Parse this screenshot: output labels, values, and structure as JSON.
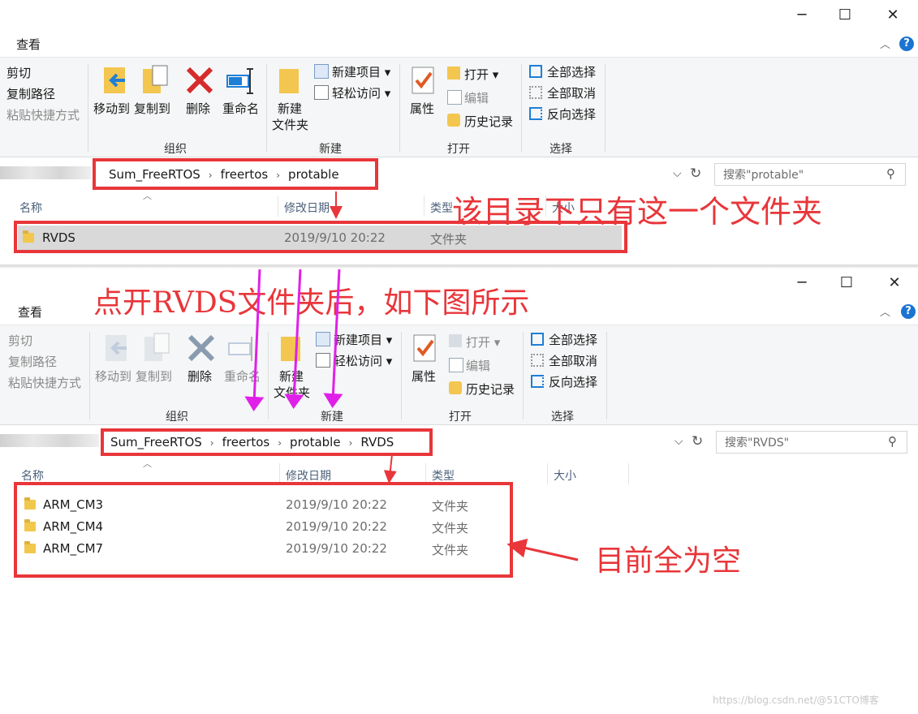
{
  "window1": {
    "title_buttons": {
      "minimize": "─",
      "maximize": "☐",
      "close": "✕"
    },
    "tab": "查看",
    "ribbon": {
      "clipboard": {
        "cut": "剪切",
        "copy_path": "复制路径",
        "paste_shortcut": "粘贴快捷方式"
      },
      "organize": {
        "move_to": "移动到",
        "copy_to": "复制到",
        "delete": "删除",
        "rename": "重命名",
        "label": "组织"
      },
      "new": {
        "new_folder_line1": "新建",
        "new_folder_line2": "文件夹",
        "new_item": "新建项目",
        "easy_access": "轻松访问",
        "label": "新建"
      },
      "open": {
        "properties": "属性",
        "open": "打开",
        "edit": "编辑",
        "history": "历史记录",
        "label": "打开"
      },
      "select": {
        "select_all": "全部选择",
        "select_none": "全部取消",
        "invert": "反向选择",
        "label": "选择"
      }
    },
    "breadcrumb": [
      "Sum_FreeRTOS",
      "freertos",
      "protable"
    ],
    "search_placeholder": "搜索\"protable\"",
    "columns": {
      "name": "名称",
      "date": "修改日期",
      "type": "类型",
      "size": "大小"
    },
    "rows": [
      {
        "name": "RVDS",
        "date": "2019/9/10 20:22",
        "type": "文件夹"
      }
    ]
  },
  "window2": {
    "title_buttons": {
      "minimize": "─",
      "maximize": "☐",
      "close": "✕"
    },
    "tab": "查看",
    "ribbon": {
      "clipboard": {
        "cut": "剪切",
        "copy_path": "复制路径",
        "paste_shortcut": "粘贴快捷方式"
      },
      "organize": {
        "move_to": "移动到",
        "copy_to": "复制到",
        "delete": "删除",
        "rename": "重命名",
        "label": "组织"
      },
      "new": {
        "new_folder_line1": "新建",
        "new_folder_line2": "文件夹",
        "new_item": "新建项目",
        "easy_access": "轻松访问",
        "label": "新建"
      },
      "open": {
        "properties": "属性",
        "open": "打开",
        "edit": "编辑",
        "history": "历史记录",
        "label": "打开"
      },
      "select": {
        "select_all": "全部选择",
        "select_none": "全部取消",
        "invert": "反向选择",
        "label": "选择"
      }
    },
    "breadcrumb": [
      "Sum_FreeRTOS",
      "freertos",
      "protable",
      "RVDS"
    ],
    "search_placeholder": "搜索\"RVDS\"",
    "columns": {
      "name": "名称",
      "date": "修改日期",
      "type": "类型",
      "size": "大小"
    },
    "rows": [
      {
        "name": "ARM_CM3",
        "date": "2019/9/10 20:22",
        "type": "文件夹"
      },
      {
        "name": "ARM_CM4",
        "date": "2019/9/10 20:22",
        "type": "文件夹"
      },
      {
        "name": "ARM_CM7",
        "date": "2019/9/10 20:22",
        "type": "文件夹"
      }
    ]
  },
  "annotations": {
    "only_folder": "该目录下只有这一个文件夹",
    "after_open": "点开RVDS文件夹后，如下图所示",
    "all_empty": "目前全为空"
  },
  "watermark": "https://blog.csdn.net/@51CTO博客",
  "colors": {
    "annotation_red": "#e8363a",
    "arrow_magenta": "#e020e8",
    "help_blue": "#1b74d2"
  }
}
